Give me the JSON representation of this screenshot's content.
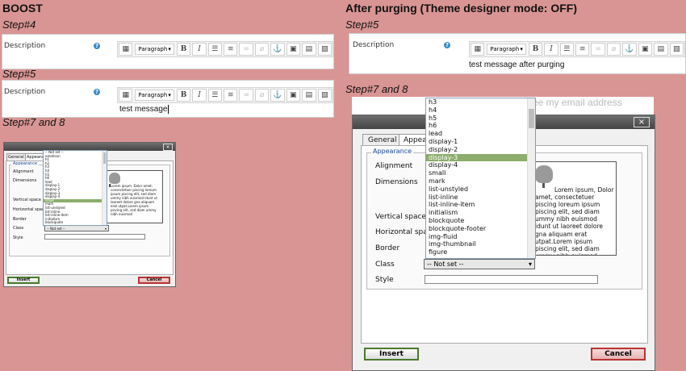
{
  "left": {
    "heading": "BOOST",
    "step4": "Step#4",
    "step5": "Step#5",
    "step78": "Step#7 and 8",
    "description_label": "Description",
    "format_select": "Paragraph",
    "editor_text": "test message",
    "dialog": {
      "tabs": [
        "General",
        "Appearance"
      ],
      "legend": "Appearance",
      "fields": [
        "Alignment",
        "Dimensions",
        "Vertical space",
        "Horizontal space",
        "Border",
        "Class",
        "Style"
      ],
      "dropdown_items": [
        "-- Not set --",
        "emoticon",
        "h1",
        "h2",
        "h3",
        "h4",
        "h5",
        "h6",
        "lead",
        "display-1",
        "display-2",
        "display-3",
        "display-4",
        "small",
        "mark",
        "list-unstyled",
        "list-inline",
        "list-inline-item",
        "initialism",
        "blockquote"
      ],
      "selected_index": 13,
      "class_value": "-- Not set --",
      "preview_text": "Lorem ipsum, Dolor amet, consectetuer piscing loreum ipsum piscing elit, sed diam ummy nibh euismod idunt ut laoreet dolore gna aliquam erat utpat.Lorem ipsum piscing elit, sed diam ummy nibh euismod",
      "insert": "Insert",
      "cancel": "Cancel"
    }
  },
  "right": {
    "heading": "After purging (Theme designer mode: OFF)",
    "step5": "Step#5",
    "step78": "Step#7 and 8",
    "description_label": "Description",
    "format_select": "Paragraph",
    "editor_text": "test message after purging",
    "ghost_text": "ee my email address",
    "dialog": {
      "tabs": [
        "General",
        "Appearance"
      ],
      "legend": "Appearance",
      "fields": [
        "Alignment",
        "Dimensions",
        "Vertical space",
        "Horizontal space",
        "Border",
        "Class",
        "Style"
      ],
      "dropdown_items": [
        "h3",
        "h4",
        "h5",
        "h6",
        "lead",
        "display-1",
        "display-2",
        "display-3",
        "display-4",
        "small",
        "mark",
        "list-unstyled",
        "list-inline",
        "list-inline-item",
        "initialism",
        "blockquote",
        "blockquote-footer",
        "img-fluid",
        "img-thumbnail",
        "figure"
      ],
      "selected_index": 7,
      "class_value": "-- Not set --",
      "preview_lines": [
        "Lorem ipsum, Dolor",
        "amet, consectetuer",
        "piscing loreum ipsum",
        "piscing elit, sed diam",
        "ummy nibh euismod",
        "idunt ut laoreet dolore",
        "gna aliquam erat",
        "utpat.Lorem ipsum",
        "piscing elit, sed diam",
        "ummy nibh euismod"
      ],
      "insert": "Insert",
      "cancel": "Cancel",
      "close": "×"
    }
  },
  "colors": {
    "background": "#d99594",
    "selected_item": "#8cad6b",
    "help_icon": "#3a87c8",
    "legend": "#1a4a9a"
  }
}
